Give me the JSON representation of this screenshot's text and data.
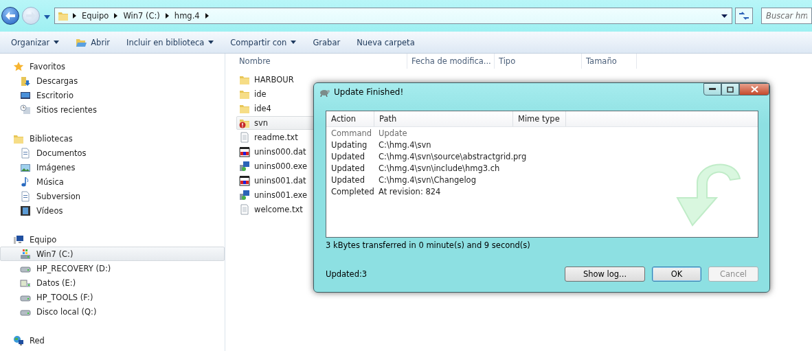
{
  "address_bar": {
    "crumbs": [
      "Equipo",
      "Win7 (C:)",
      "hmg.4"
    ],
    "search": {
      "placeholder": "Buscar hm"
    }
  },
  "toolbar": [
    {
      "label": "Organizar",
      "has_menu": true,
      "kind": "plain"
    },
    {
      "label": "Abrir",
      "has_menu": false,
      "kind": "open"
    },
    {
      "label": "Incluir en biblioteca",
      "has_menu": true,
      "kind": "plain"
    },
    {
      "label": "Compartir con",
      "has_menu": true,
      "kind": "plain"
    },
    {
      "label": "Grabar",
      "has_menu": false,
      "kind": "plain"
    },
    {
      "label": "Nueva carpeta",
      "has_menu": false,
      "kind": "plain"
    }
  ],
  "sidebar": {
    "groups": [
      {
        "label": "Favoritos",
        "kind": "star",
        "children": [
          {
            "label": "Descargas",
            "kind": "downloads",
            "selected": false
          },
          {
            "label": "Escritorio",
            "kind": "desktop",
            "selected": false
          },
          {
            "label": "Sitios recientes",
            "kind": "recent",
            "selected": false
          }
        ]
      },
      {
        "label": "Bibliotecas",
        "kind": "library",
        "children": [
          {
            "label": "Documentos",
            "kind": "document",
            "selected": false
          },
          {
            "label": "Imágenes",
            "kind": "image",
            "selected": false
          },
          {
            "label": "Música",
            "kind": "music",
            "selected": false
          },
          {
            "label": "Subversion",
            "kind": "document",
            "selected": false
          },
          {
            "label": "Vídeos",
            "kind": "video",
            "selected": false
          }
        ]
      },
      {
        "label": "Equipo",
        "kind": "computer",
        "children": [
          {
            "label": "Win7 (C:)",
            "kind": "system-drive",
            "selected": true
          },
          {
            "label": "HP_RECOVERY (D:)",
            "kind": "drive",
            "selected": false
          },
          {
            "label": "Datos (E:)",
            "kind": "network-drive",
            "selected": false
          },
          {
            "label": "HP_TOOLS (F:)",
            "kind": "drive",
            "selected": false
          },
          {
            "label": "Disco local (Q:)",
            "kind": "drive",
            "selected": false
          }
        ]
      },
      {
        "label": "Red",
        "kind": "network"
      }
    ]
  },
  "file_list": {
    "columns": [
      "Nombre",
      "Fecha de modifica...",
      "Tipo",
      "Tamaño"
    ],
    "rows": [
      {
        "name": "HARBOUR",
        "kind": "folder",
        "selected": false
      },
      {
        "name": "ide",
        "kind": "folder",
        "selected": false
      },
      {
        "name": "ide4",
        "kind": "folder",
        "selected": false
      },
      {
        "name": "svn",
        "kind": "folder-conflict",
        "selected": true
      },
      {
        "name": "readme.txt",
        "kind": "text",
        "selected": false
      },
      {
        "name": "unins000.dat",
        "kind": "dat",
        "selected": false
      },
      {
        "name": "unins000.exe",
        "kind": "exe",
        "selected": false
      },
      {
        "name": "unins001.dat",
        "kind": "dat",
        "selected": false
      },
      {
        "name": "unins001.exe",
        "kind": "exe",
        "selected": false
      },
      {
        "name": "welcome.txt",
        "kind": "text",
        "selected": false
      }
    ]
  },
  "dialog": {
    "title": "Update Finished!",
    "columns": [
      "Action",
      "Path",
      "Mime type"
    ],
    "rows": [
      {
        "action": "Command",
        "path": "Update",
        "kind": "command"
      },
      {
        "action": "Updating",
        "path": "C:\\hmg.4\\svn",
        "kind": "entry"
      },
      {
        "action": "Updated",
        "path": "C:\\hmg.4\\svn\\source\\abstractgrid.prg",
        "kind": "entry"
      },
      {
        "action": "Updated",
        "path": "C:\\hmg.4\\svn\\include\\hmg3.ch",
        "kind": "entry"
      },
      {
        "action": "Updated",
        "path": "C:\\hmg.4\\svn\\Changelog",
        "kind": "entry"
      },
      {
        "action": "Completed",
        "path": "At revision: 824",
        "kind": "entry"
      }
    ],
    "transfer": "3 kBytes transferred in 0 minute(s) and 9 second(s)",
    "summary": "Updated:3",
    "buttons": [
      {
        "label": "Show log...",
        "default": false,
        "disabled": false
      },
      {
        "label": "OK",
        "default": true,
        "disabled": false
      },
      {
        "label": "Cancel",
        "default": false,
        "disabled": true
      }
    ]
  }
}
